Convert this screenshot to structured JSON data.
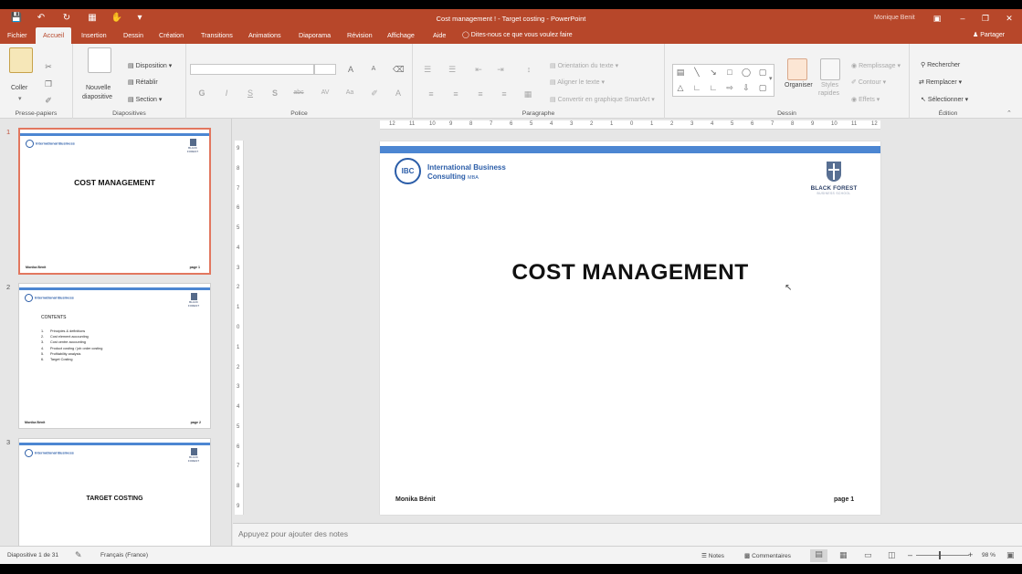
{
  "window": {
    "title": "Cost management ! - Target costing  -  PowerPoint",
    "user": "Monique Benit"
  },
  "tabs": {
    "file": "Fichier",
    "home": "Accueil",
    "insert": "Insertion",
    "design": "Dessin",
    "create": "Création",
    "transitions": "Transitions",
    "animations": "Animations",
    "slideshow": "Diaporama",
    "review": "Révision",
    "view": "Affichage",
    "help": "Aide",
    "tell_me": "Dites-nous ce que vous voulez faire",
    "share": "Partager"
  },
  "ribbon": {
    "clipboard": {
      "paste": "Coller",
      "label": "Presse-papiers"
    },
    "slides": {
      "new_slide_line1": "Nouvelle",
      "new_slide_line2": "diapositive",
      "layout": "Disposition",
      "reset": "Rétablir",
      "section": "Section",
      "label": "Diapositives"
    },
    "font": {
      "bold": "G",
      "italic": "I",
      "underline": "S",
      "shadow": "S",
      "strike": "abc",
      "spacing": "AV",
      "case": "Aa",
      "color": "A",
      "grow": "A",
      "shrink": "A",
      "label": "Police"
    },
    "paragraph": {
      "orientation": "Orientation du texte",
      "align_text": "Aligner le texte",
      "smartart": "Convertir en graphique SmartArt",
      "label": "Paragraphe"
    },
    "drawing": {
      "arrange": "Organiser",
      "quick_styles_line1": "Styles",
      "quick_styles_line2": "rapides",
      "fill": "Remplissage",
      "outline": "Contour",
      "effects": "Effets",
      "label": "Dessin"
    },
    "editing": {
      "find": "Rechercher",
      "replace": "Remplacer",
      "select": "Sélectionner",
      "label": "Édition"
    }
  },
  "thumbnails": [
    {
      "number": "1",
      "title": "COST MANAGEMENT",
      "author": "Monika Bénit",
      "page": "page 1"
    },
    {
      "number": "2",
      "heading": "CONTENTS",
      "author": "Monika Bénit",
      "page": "page 2",
      "items": [
        {
          "n": "1.",
          "t": "Principles & definitions"
        },
        {
          "n": "2.",
          "t": "Cost element accounting"
        },
        {
          "n": "3.",
          "t": "Cost centre accounting"
        },
        {
          "n": "4.",
          "t": "Product costing / job order costing"
        },
        {
          "n": "5.",
          "t": "Profitability analysis"
        },
        {
          "n": "6.",
          "t": "Target Costing"
        }
      ]
    },
    {
      "number": "3",
      "title": "TARGET COSTING"
    }
  ],
  "thumb_logo": {
    "line1": "International Business",
    "line2": "Consulting MBA",
    "crest": "BLACK FOREST"
  },
  "slide": {
    "logo_abbr": "IBC",
    "logo_line1": "International Business",
    "logo_line2": "Consulting",
    "logo_mba": "MBA",
    "crest_name": "BLACK FOREST",
    "crest_sub": "BUSINESS SCHOOL",
    "title": "COST MANAGEMENT",
    "author": "Monika Bénit",
    "page": "page 1"
  },
  "ruler": {
    "top": [
      "12",
      "11",
      "10",
      "9",
      "8",
      "7",
      "6",
      "5",
      "4",
      "3",
      "2",
      "1",
      "0",
      "1",
      "2",
      "3",
      "4",
      "5",
      "6",
      "7",
      "8",
      "9",
      "10",
      "11",
      "12"
    ],
    "left": [
      "9",
      "8",
      "7",
      "6",
      "5",
      "4",
      "3",
      "2",
      "1",
      "0",
      "1",
      "2",
      "3",
      "4",
      "5",
      "6",
      "7",
      "8",
      "9"
    ]
  },
  "notes": {
    "placeholder": "Appuyez pour ajouter des notes"
  },
  "status": {
    "slide_info": "Diapositive 1 de 31",
    "language": "Français (France)",
    "notes": "Notes",
    "comments": "Commentaires",
    "zoom": "98 %"
  }
}
